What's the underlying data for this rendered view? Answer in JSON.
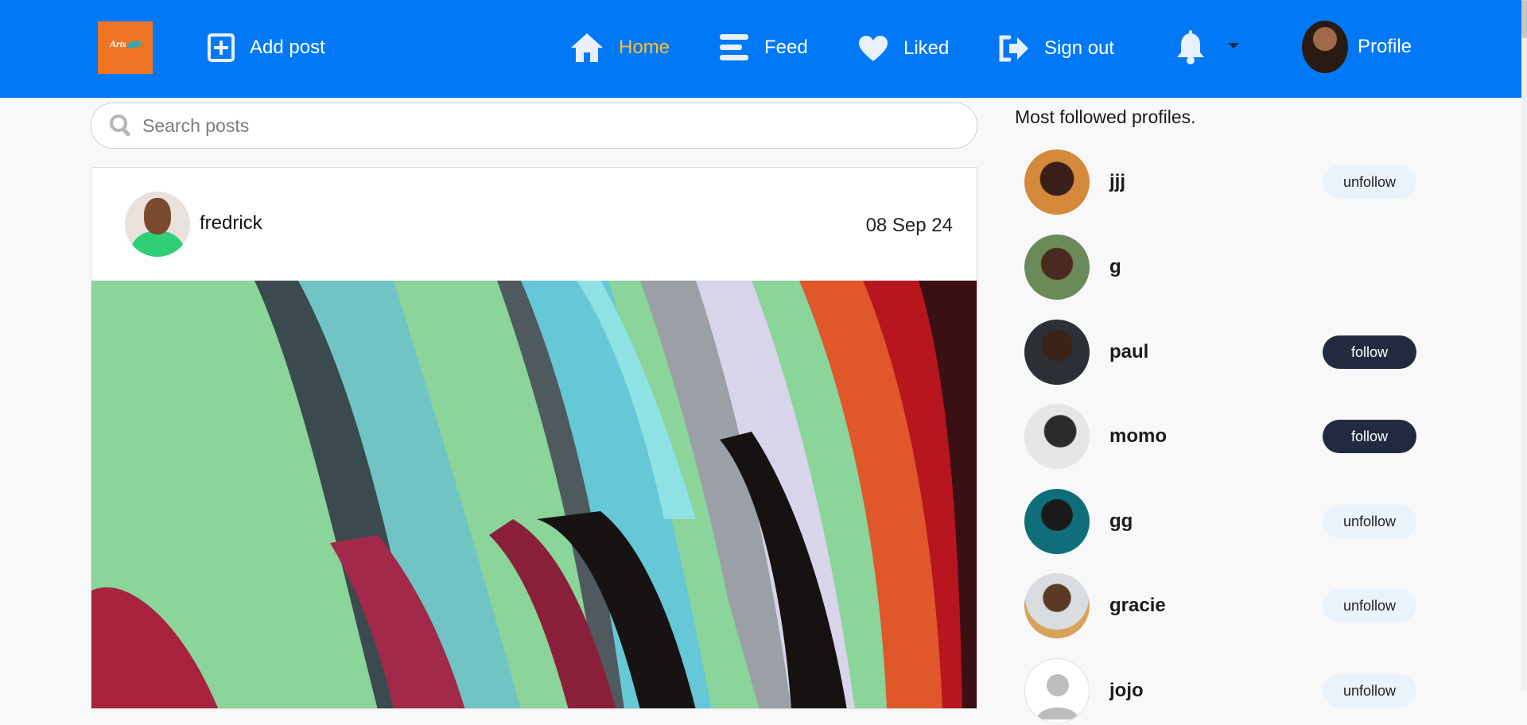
{
  "header": {
    "logo_text": "Arts",
    "add_post_label": "Add post",
    "home_label": "Home",
    "feed_label": "Feed",
    "liked_label": "Liked",
    "signout_label": "Sign out",
    "profile_label": "Profile"
  },
  "search": {
    "placeholder": "Search posts"
  },
  "post": {
    "author": "fredrick",
    "date": "08 Sep 24"
  },
  "sidebar": {
    "title": "Most followed profiles.",
    "profiles": [
      {
        "name": "jjj",
        "action": "unfollow"
      },
      {
        "name": "g",
        "action": ""
      },
      {
        "name": "paul",
        "action": "follow"
      },
      {
        "name": "momo",
        "action": "follow"
      },
      {
        "name": "gg",
        "action": "unfollow"
      },
      {
        "name": "gracie",
        "action": "unfollow"
      },
      {
        "name": "jojo",
        "action": "unfollow"
      }
    ]
  },
  "colors": {
    "header_bg": "#0179f6",
    "active_nav": "#ffbd2b",
    "follow_btn": "#222a40",
    "unfollow_btn": "#eaf2fb"
  }
}
